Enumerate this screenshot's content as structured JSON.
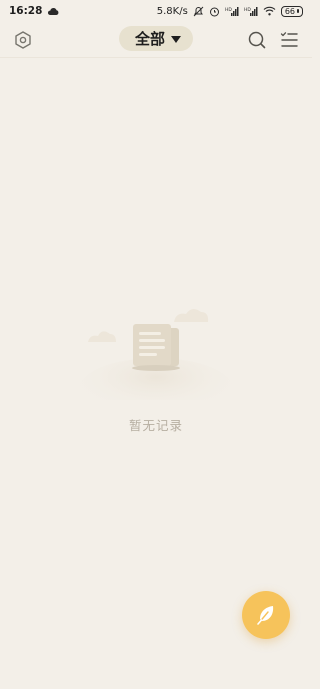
{
  "status_bar": {
    "time": "16:28",
    "net_speed": "5.8K/s",
    "battery": "66"
  },
  "header": {
    "filter_label": "全部"
  },
  "empty_state": {
    "message": "暂无记录"
  },
  "colors": {
    "background": "#f3efe8",
    "pill": "#e7e1cf",
    "fab": "#f6c35b",
    "empty_text": "#b6aea1"
  },
  "icons": {
    "settings": "hexagon-settings-icon",
    "search": "search-icon",
    "checklist": "checklist-menu-icon",
    "fab": "feather-icon"
  }
}
